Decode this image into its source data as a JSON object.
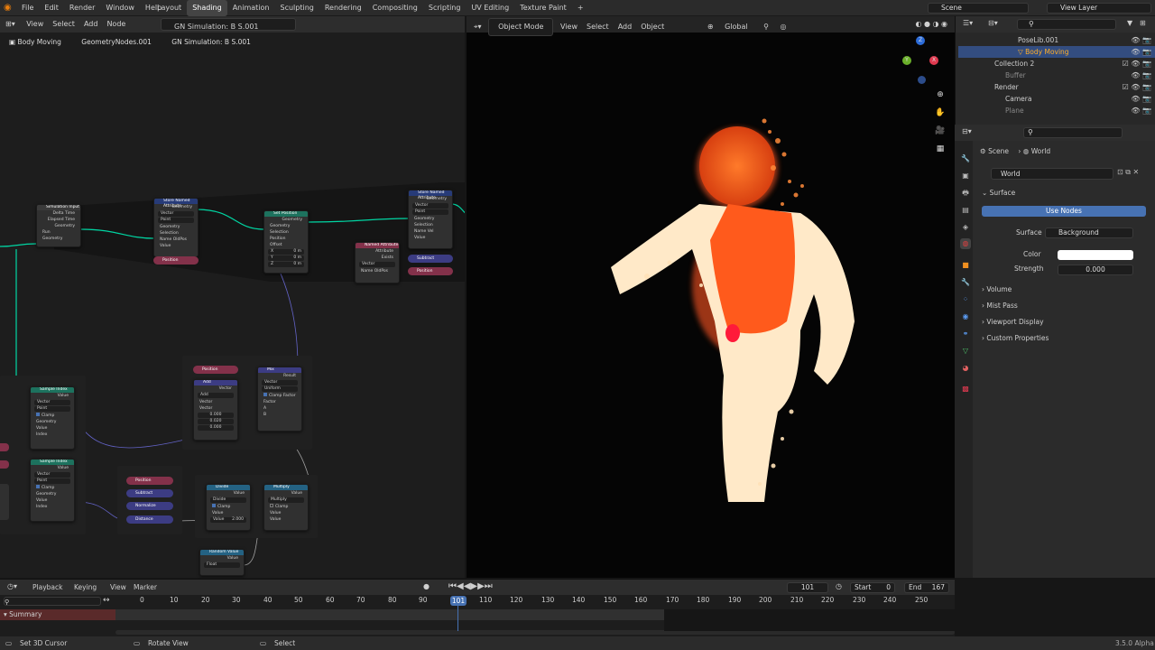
{
  "topmenu": [
    "File",
    "Edit",
    "Render",
    "Window",
    "Help"
  ],
  "workspaces": [
    {
      "label": "Layout",
      "active": false
    },
    {
      "label": "Shading",
      "active": true
    },
    {
      "label": "Animation",
      "active": false
    },
    {
      "label": "Sculpting",
      "active": false
    },
    {
      "label": "Rendering",
      "active": false
    },
    {
      "label": "Compositing",
      "active": false
    },
    {
      "label": "Scripting",
      "active": false
    },
    {
      "label": "UV Editing",
      "active": false
    },
    {
      "label": "Texture Paint",
      "active": false
    },
    {
      "label": "+",
      "active": false
    }
  ],
  "scene_field": "Scene",
  "view_layer_field": "View Layer",
  "node_editor": {
    "menu": [
      "View",
      "Select",
      "Add",
      "Node"
    ],
    "node_tree_name": "GN Simulation: B S.001",
    "breadcrumb": [
      "Body Moving",
      "GeometryNodes.001",
      "GN Simulation: B S.001"
    ]
  },
  "nodes": {
    "sim_input": {
      "title": "Simulation Input",
      "rows": [
        "Delta Time",
        "Elapsed Time",
        "Geometry",
        "Run",
        "Geometry"
      ]
    },
    "store1": {
      "title": "Store Named Attribute",
      "rows": [
        "Geometry",
        "Vector",
        "Point",
        "Geometry",
        "Selection",
        "Name",
        "Value"
      ],
      "name_value": "OldPos"
    },
    "pos1": "Position",
    "set_position": {
      "title": "Set Position",
      "rows": [
        "Geometry",
        "Geometry",
        "Selection",
        "Position",
        "Offset",
        "X",
        "Y",
        "Z"
      ],
      "offset": [
        "0 m",
        "0 m",
        "0 m"
      ]
    },
    "named_attr": {
      "title": "Named Attribute",
      "rows": [
        "Attribute",
        "Exists",
        "Vector",
        "Name"
      ],
      "name_value": "OldPos"
    },
    "store2": {
      "title": "Store Named Attribute",
      "rows": [
        "Geometry",
        "Vector",
        "Point",
        "Geometry",
        "Selection",
        "Name",
        "Value"
      ],
      "name_value": "Vel"
    },
    "subtract1": "Subtract",
    "pos2": "Position",
    "pos3": "Position",
    "add_node": {
      "title": "Add",
      "rows": [
        "Vector",
        "Add",
        "Vector",
        "Vector",
        "0.000",
        "0.020",
        "0.000"
      ]
    },
    "mix": {
      "title": "Mix",
      "rows": [
        "Result",
        "Vector",
        "Uniform",
        "Clamp Factor",
        "Factor",
        "A",
        "B"
      ]
    },
    "sample1": {
      "title": "Sample Index",
      "rows": [
        "Value",
        "Vector",
        "Point",
        "Clamp",
        "Geometry",
        "Value",
        "Index"
      ]
    },
    "sample2": {
      "title": "Sample Index",
      "rows": [
        "Value",
        "Vector",
        "Point",
        "Clamp",
        "Geometry",
        "Value",
        "Index"
      ]
    },
    "pos4": "Position",
    "subtract2": "Subtract",
    "normalize": "Normalize",
    "distance": "Distance",
    "divide": {
      "title": "Divide",
      "rows": [
        "Value",
        "Divide",
        "Clamp",
        "Value",
        "Value"
      ],
      "value": "2.000"
    },
    "multiply": {
      "title": "Multiply",
      "rows": [
        "Value",
        "Multiply",
        "Clamp",
        "Value",
        "Value"
      ]
    },
    "random": {
      "title": "Random Value",
      "rows": [
        "Value",
        "Float"
      ]
    }
  },
  "viewport": {
    "menu": [
      "View",
      "Select",
      "Add",
      "Object"
    ],
    "mode": "Object Mode",
    "orientation": "Global",
    "gizmo_axes": [
      "Z",
      "Y",
      "X"
    ]
  },
  "outliner": {
    "search_placeholder": "",
    "rows": [
      {
        "label": "PoseLib.001",
        "indent": 3,
        "selected": false
      },
      {
        "label": "Body Moving",
        "indent": 3,
        "selected": true
      },
      {
        "label": "Collection 2",
        "indent": 1,
        "selected": false
      },
      {
        "label": "Buffer",
        "indent": 2,
        "selected": false
      },
      {
        "label": "Render",
        "indent": 1,
        "selected": false
      },
      {
        "label": "Camera",
        "indent": 2,
        "selected": false
      },
      {
        "label": "Plane",
        "indent": 2,
        "selected": false
      }
    ]
  },
  "properties": {
    "breadcrumb": [
      "Scene",
      "World"
    ],
    "world_name": "World",
    "surface_panel": "Surface",
    "use_nodes": "Use Nodes",
    "surface_label": "Surface",
    "surface_value": "Background",
    "color_label": "Color",
    "strength_label": "Strength",
    "strength_value": "0.000",
    "panels": [
      "Volume",
      "Mist Pass",
      "Viewport Display",
      "Custom Properties"
    ]
  },
  "timeline": {
    "menu": [
      "Playback",
      "Keying",
      "View",
      "Marker"
    ],
    "current_frame": "101",
    "start_label": "Start",
    "start": "0",
    "end_label": "End",
    "end": "167",
    "ticks": [
      "0",
      "10",
      "20",
      "30",
      "40",
      "50",
      "60",
      "70",
      "80",
      "90",
      "101",
      "110",
      "120",
      "130",
      "140",
      "150",
      "160",
      "170",
      "180",
      "190",
      "200",
      "210",
      "220",
      "230",
      "240",
      "250"
    ],
    "summary": "Summary"
  },
  "statusbar": {
    "items": [
      "Set 3D Cursor",
      "Rotate View",
      "Select"
    ],
    "version": "3.5.0 Alpha"
  }
}
